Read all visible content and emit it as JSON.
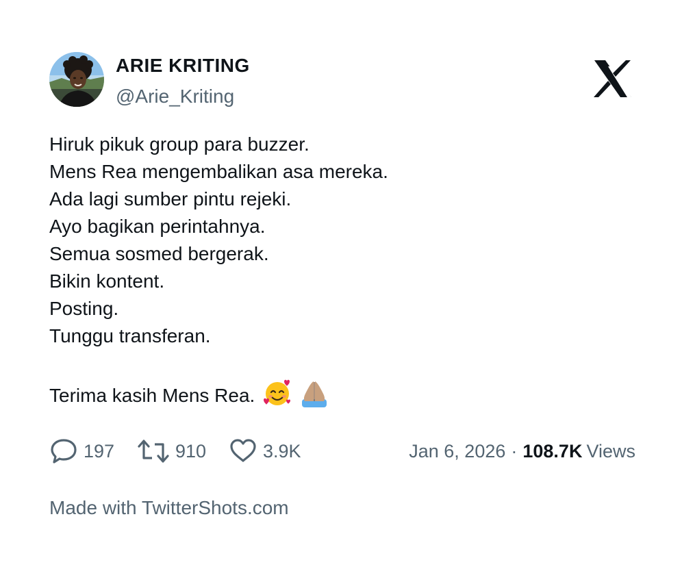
{
  "author": {
    "name": "ARIE KRITING",
    "handle": "@Arie_Kriting"
  },
  "platform_logo": "x-logo-icon",
  "tweet": {
    "lines": [
      "Hiruk pikuk group para buzzer.",
      "Mens Rea mengembalikan asa mereka.",
      "Ada lagi sumber pintu rejeki.",
      "Ayo bagikan perintahnya.",
      "Semua sosmed bergerak.",
      "Bikin kontent.",
      "Posting.",
      "Tunggu transferan."
    ],
    "closing": "Terima kasih Mens Rea.",
    "emojis": [
      "smiling-face-with-hearts-icon",
      "folded-hands-icon"
    ]
  },
  "stats": {
    "replies": "197",
    "retweets": "910",
    "likes": "3.9K",
    "date": "Jan 6, 2026",
    "separator": "·",
    "views_count": "108.7K",
    "views_label": "Views"
  },
  "footer": {
    "text": "Made with TwitterShots.com"
  },
  "colors": {
    "text_primary": "#0f1419",
    "text_secondary": "#536471",
    "background": "#ffffff"
  }
}
